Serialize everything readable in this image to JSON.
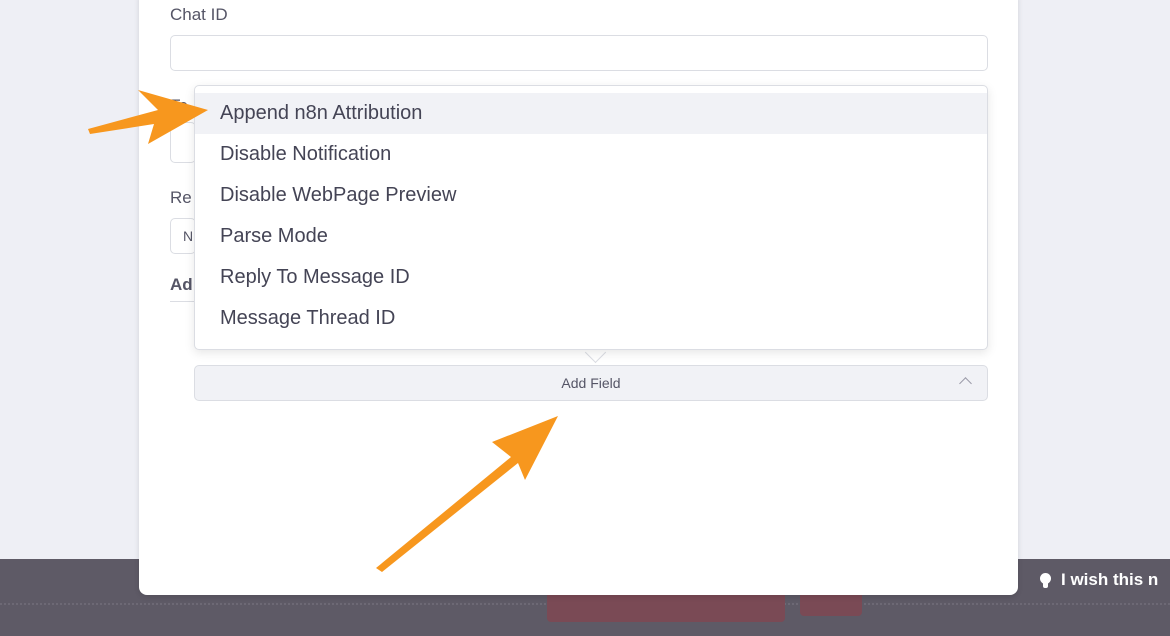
{
  "form": {
    "chat_id_label": "Chat ID",
    "chat_id_value": "",
    "text_label_partial": "Te",
    "reply_label_partial": "Re",
    "reply_value_partial": "N",
    "additional_label_partial": "Ad"
  },
  "dropdown": {
    "items": [
      {
        "label": "Append n8n Attribution",
        "highlighted": true
      },
      {
        "label": "Disable Notification"
      },
      {
        "label": "Disable WebPage Preview"
      },
      {
        "label": "Parse Mode"
      },
      {
        "label": "Reply To Message ID"
      },
      {
        "label": "Message Thread ID"
      }
    ]
  },
  "add_field": {
    "label": "Add Field",
    "icon": "chevron-up-icon"
  },
  "footer": {
    "feedback_text": "I wish this n",
    "icon": "lightbulb-icon"
  },
  "colors": {
    "background": "#eeeff5",
    "panel": "#ffffff",
    "bottom_bar": "#5e5a66",
    "annotation_arrow": "#f7971e",
    "hover_row": "#f1f2f6"
  }
}
